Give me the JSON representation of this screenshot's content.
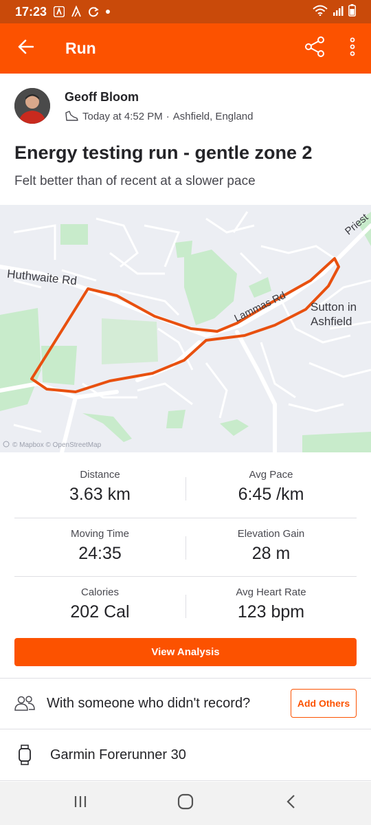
{
  "status_bar": {
    "time": "17:23",
    "icons": [
      "strava-notification-icon",
      "activity-notification-icon",
      "sync-icon",
      "dot-icon"
    ],
    "right_icons": [
      "wifi-icon",
      "signal-icon",
      "battery-icon"
    ]
  },
  "app_bar": {
    "title": "Run",
    "icons": [
      "back-arrow-icon",
      "share-icon",
      "more-vertical-icon"
    ]
  },
  "athlete": {
    "name": "Geoff Bloom",
    "time": "Today at 4:52 PM",
    "separator": "·",
    "location": "Ashfield, England"
  },
  "activity": {
    "title": "Energy testing run - gentle zone 2",
    "description": "Felt better than of recent at a slower pace"
  },
  "map": {
    "labels": {
      "huthwaite": "Huthwaite Rd",
      "lammas": "Lammas Rd",
      "priest": "Priest",
      "sutton_line1": "Sutton in",
      "sutton_line2": "Ashfield"
    },
    "attribution": "© Mapbox © OpenStreetMap",
    "route_color": "#e8500f"
  },
  "stats": [
    [
      {
        "label": "Distance",
        "value": "3.63 km"
      },
      {
        "label": "Avg Pace",
        "value": "6:45 /km"
      }
    ],
    [
      {
        "label": "Moving Time",
        "value": "24:35"
      },
      {
        "label": "Elevation Gain",
        "value": "28 m"
      }
    ],
    [
      {
        "label": "Calories",
        "value": "202 Cal"
      },
      {
        "label": "Avg Heart Rate",
        "value": "123 bpm"
      }
    ]
  ],
  "view_analysis_label": "View Analysis",
  "with_others": {
    "text": "With someone who didn't record?",
    "button_label": "Add Others"
  },
  "device": {
    "name": "Garmin Forerunner 30"
  },
  "nav_bar": {
    "icons": [
      "recent-apps-icon",
      "home-icon",
      "back-icon"
    ]
  },
  "colors": {
    "brand": "#fc5200",
    "status_bar": "#c94a0a",
    "text": "#242428",
    "map_background": "#eceef3"
  }
}
